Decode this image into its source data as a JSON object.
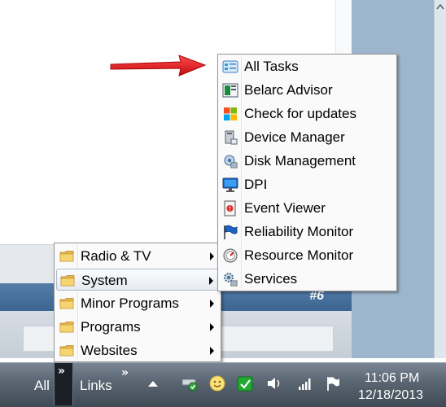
{
  "background": {
    "band_label": "#6"
  },
  "links_menu": {
    "items": [
      {
        "label": "Radio & TV",
        "icon": "folder-icon",
        "submenu": true
      },
      {
        "label": "System",
        "icon": "folder-icon",
        "submenu": true,
        "selected": true
      },
      {
        "label": "Minor Programs",
        "icon": "folder-icon",
        "submenu": true
      },
      {
        "label": "Programs",
        "icon": "folder-icon",
        "submenu": true
      },
      {
        "label": "Websites",
        "icon": "folder-icon",
        "submenu": true
      }
    ]
  },
  "system_menu": {
    "items": [
      {
        "label": "All Tasks",
        "icon": "control-panel-icon"
      },
      {
        "label": "Belarc Advisor",
        "icon": "belarc-icon"
      },
      {
        "label": "Check for updates",
        "icon": "windows-update-icon"
      },
      {
        "label": "Device Manager",
        "icon": "device-manager-icon"
      },
      {
        "label": "Disk Management",
        "icon": "disk-management-icon"
      },
      {
        "label": "DPI",
        "icon": "monitor-icon"
      },
      {
        "label": "Event Viewer",
        "icon": "event-viewer-icon"
      },
      {
        "label": "Reliability Monitor",
        "icon": "reliability-flag-icon"
      },
      {
        "label": "Resource Monitor",
        "icon": "resource-monitor-icon"
      },
      {
        "label": "Services",
        "icon": "services-gear-icon"
      }
    ]
  },
  "taskbar": {
    "all_label": "All",
    "links_label": "Links",
    "time": "11:06 PM",
    "date": "12/18/2013",
    "toolbar_chevron": "»"
  },
  "colors": {
    "arrow": "#e3171b",
    "taskbar_dark": "#3f4a55",
    "band_blue": "#3c6591",
    "folder_yellow": "#f1c75a"
  }
}
